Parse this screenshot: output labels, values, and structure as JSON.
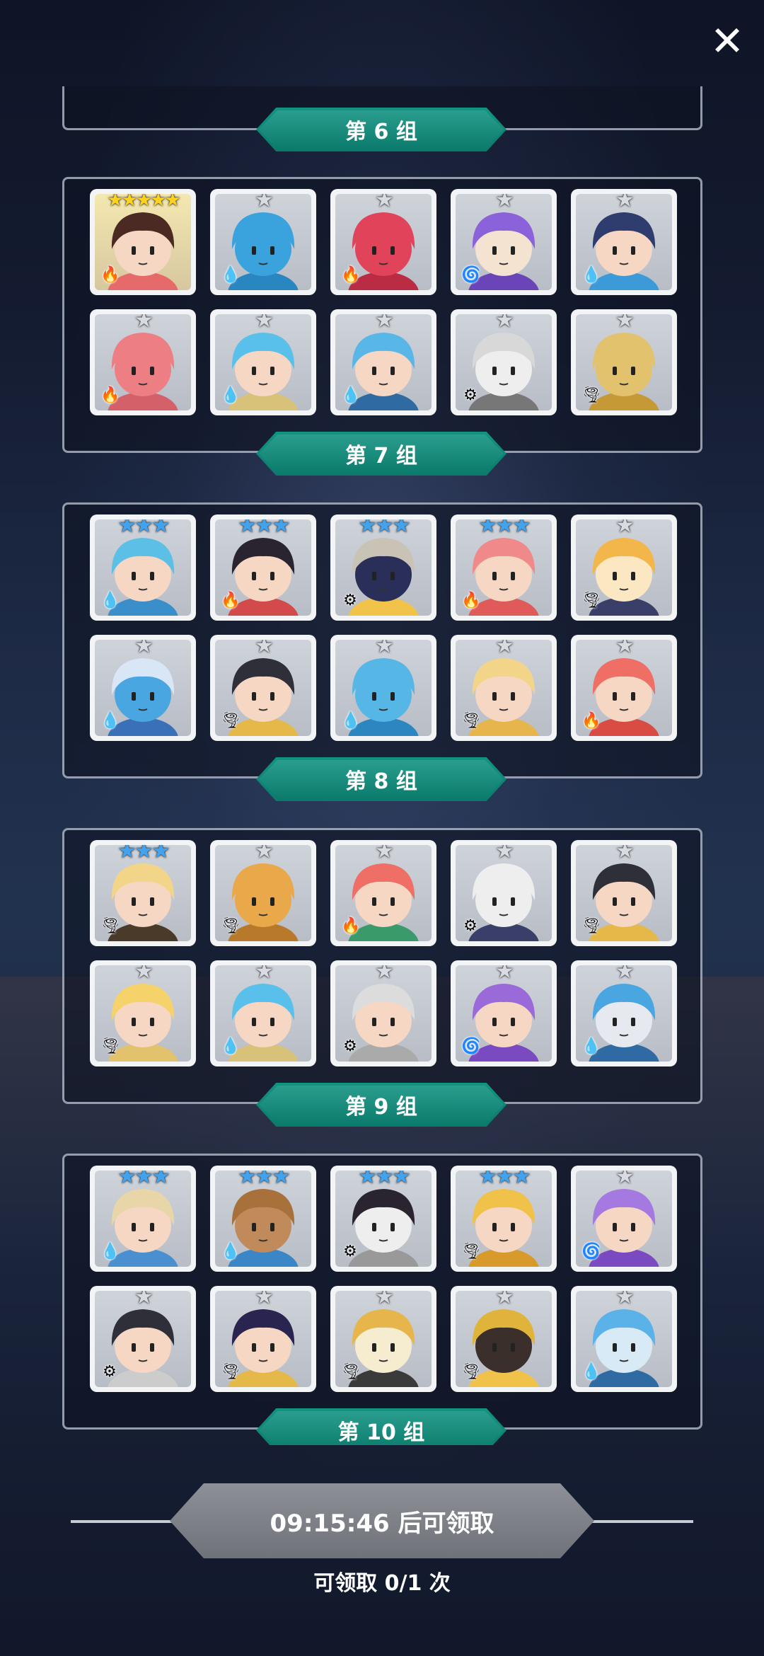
{
  "close_label": "✕",
  "groups": [
    {
      "label": "第 6 组"
    },
    {
      "label": "第 7 组"
    },
    {
      "label": "第 8 组"
    },
    {
      "label": "第 9 组"
    },
    {
      "label": "第 10 组"
    }
  ],
  "panels": [
    {
      "heroes": [
        {
          "stars": 5,
          "element": "fire",
          "hair": "#4a2a22",
          "skin": "#f6d7c3",
          "accent": "#e66a6a",
          "glow": true
        },
        {
          "stars": 1,
          "element": "water",
          "hair": "#3aa2dd",
          "skin": "#3aa2dd",
          "accent": "#2a86c0"
        },
        {
          "stars": 1,
          "element": "fire",
          "hair": "#e0435a",
          "skin": "#e0435a",
          "accent": "#b92c44"
        },
        {
          "stars": 1,
          "element": "dark",
          "hair": "#8b62d9",
          "skin": "#f4e3d0",
          "accent": "#6b45b7"
        },
        {
          "stars": 1,
          "element": "water",
          "hair": "#2f3d6e",
          "skin": "#f6d7c3",
          "accent": "#3d9ad8"
        },
        {
          "stars": 1,
          "element": "fire",
          "hair": "#ec7e84",
          "skin": "#ec7e84",
          "accent": "#d4606a"
        },
        {
          "stars": 1,
          "element": "water",
          "hair": "#58c0ea",
          "skin": "#f6d7c3",
          "accent": "#d8c27a"
        },
        {
          "stars": 1,
          "element": "water",
          "hair": "#59b7e8",
          "skin": "#f6d7c3",
          "accent": "#2f6aa3"
        },
        {
          "stars": 1,
          "element": "light",
          "hair": "#d8d8d8",
          "skin": "#eeeeee",
          "accent": "#777777"
        },
        {
          "stars": 1,
          "element": "earth",
          "hair": "#e3c26e",
          "skin": "#e3c26e",
          "accent": "#c59a36"
        }
      ]
    },
    {
      "heroes": [
        {
          "stars": 3,
          "element": "water",
          "hair": "#5cc0e6",
          "skin": "#f6d7c3",
          "accent": "#3a8fcb"
        },
        {
          "stars": 3,
          "element": "fire",
          "hair": "#2a2430",
          "skin": "#f6d7c3",
          "accent": "#d24a4a"
        },
        {
          "stars": 3,
          "element": "light",
          "hair": "#c9c3b6",
          "skin": "#2a2f5a",
          "accent": "#f1c348"
        },
        {
          "stars": 3,
          "element": "fire",
          "hair": "#f08a8a",
          "skin": "#f6d7c3",
          "accent": "#e05a5a"
        },
        {
          "stars": 1,
          "element": "earth",
          "hair": "#f2b64a",
          "skin": "#fbe7c2",
          "accent": "#3a3f6a"
        },
        {
          "stars": 1,
          "element": "water",
          "hair": "#d9e6f6",
          "skin": "#4aa6e0",
          "accent": "#3a70b8"
        },
        {
          "stars": 1,
          "element": "earth",
          "hair": "#2f2f3a",
          "skin": "#f6d7c3",
          "accent": "#e5b84a"
        },
        {
          "stars": 1,
          "element": "water",
          "hair": "#56b6e6",
          "skin": "#56b6e6",
          "accent": "#2c86bf"
        },
        {
          "stars": 1,
          "element": "earth",
          "hair": "#f3d58a",
          "skin": "#f6d7c3",
          "accent": "#e6b64c"
        },
        {
          "stars": 1,
          "element": "fire",
          "hair": "#ef6e66",
          "skin": "#f6d7c3",
          "accent": "#d84c44"
        }
      ]
    },
    {
      "heroes": [
        {
          "stars": 3,
          "element": "earth",
          "hair": "#f3d58a",
          "skin": "#f6d7c3",
          "accent": "#4a3a2a"
        },
        {
          "stars": 1,
          "element": "earth",
          "hair": "#e9a94a",
          "skin": "#e9a94a",
          "accent": "#b8792a"
        },
        {
          "stars": 1,
          "element": "fire",
          "hair": "#ef6e66",
          "skin": "#f6d7c3",
          "accent": "#3a9a6a"
        },
        {
          "stars": 1,
          "element": "light",
          "hair": "#eeeeee",
          "skin": "#eeeeee",
          "accent": "#3a3f6a"
        },
        {
          "stars": 1,
          "element": "earth",
          "hair": "#2f2f3a",
          "skin": "#f6d7c3",
          "accent": "#e5b84a"
        },
        {
          "stars": 1,
          "element": "earth",
          "hair": "#f5d36a",
          "skin": "#f6d7c3",
          "accent": "#e3c26e"
        },
        {
          "stars": 1,
          "element": "water",
          "hair": "#58c0ea",
          "skin": "#f6d7c3",
          "accent": "#d8c27a"
        },
        {
          "stars": 1,
          "element": "light",
          "hair": "#dcdcdc",
          "skin": "#f6d7c3",
          "accent": "#aaaaaa"
        },
        {
          "stars": 1,
          "element": "dark",
          "hair": "#9b6ad9",
          "skin": "#f6d7c3",
          "accent": "#7a4ac0"
        },
        {
          "stars": 1,
          "element": "water",
          "hair": "#4aa6e0",
          "skin": "#e6eaf0",
          "accent": "#2f6aa3"
        }
      ]
    },
    {
      "heroes": [
        {
          "stars": 3,
          "element": "water",
          "hair": "#e8d6a8",
          "skin": "#f6d7c3",
          "accent": "#4a90d0"
        },
        {
          "stars": 3,
          "element": "water",
          "hair": "#a8703a",
          "skin": "#c08a5a",
          "accent": "#3a86c6"
        },
        {
          "stars": 3,
          "element": "light",
          "hair": "#2a2430",
          "skin": "#eeeeee",
          "accent": "#999999"
        },
        {
          "stars": 3,
          "element": "earth",
          "hair": "#f0c24a",
          "skin": "#f6d7c3",
          "accent": "#d89a2a"
        },
        {
          "stars": 1,
          "element": "dark",
          "hair": "#a47ae0",
          "skin": "#f6d7c3",
          "accent": "#7a4ac0"
        },
        {
          "stars": 1,
          "element": "light",
          "hair": "#2f2f3a",
          "skin": "#f6d7c3",
          "accent": "#cccccc"
        },
        {
          "stars": 1,
          "element": "earth",
          "hair": "#2a2450",
          "skin": "#f6d7c3",
          "accent": "#e5b84a"
        },
        {
          "stars": 1,
          "element": "earth",
          "hair": "#e6b64c",
          "skin": "#f6ecd0",
          "accent": "#3a3a3a"
        },
        {
          "stars": 1,
          "element": "earth",
          "hair": "#e0b43a",
          "skin": "#3a2f2a",
          "accent": "#f0c24a"
        },
        {
          "stars": 1,
          "element": "water",
          "hair": "#5ab2e8",
          "skin": "#d8eaf6",
          "accent": "#2f6aa3"
        }
      ]
    }
  ],
  "top_partial_panel": {
    "visible": true
  },
  "claim": {
    "button_label": "09:15:46 后可领取",
    "count_label": "可领取 0/1 次"
  },
  "element_icons": {
    "fire": "🔥",
    "water": "💧",
    "light": "⚙",
    "earth": "🌪",
    "dark": "🌀"
  },
  "colors": {
    "group_label_bg": "#0b7a6b",
    "claim_button_bg": "#7b7e85",
    "star_gold": "#ffd21e",
    "star_blue": "#3fa3f0",
    "star_silver": "#d8dce2"
  }
}
